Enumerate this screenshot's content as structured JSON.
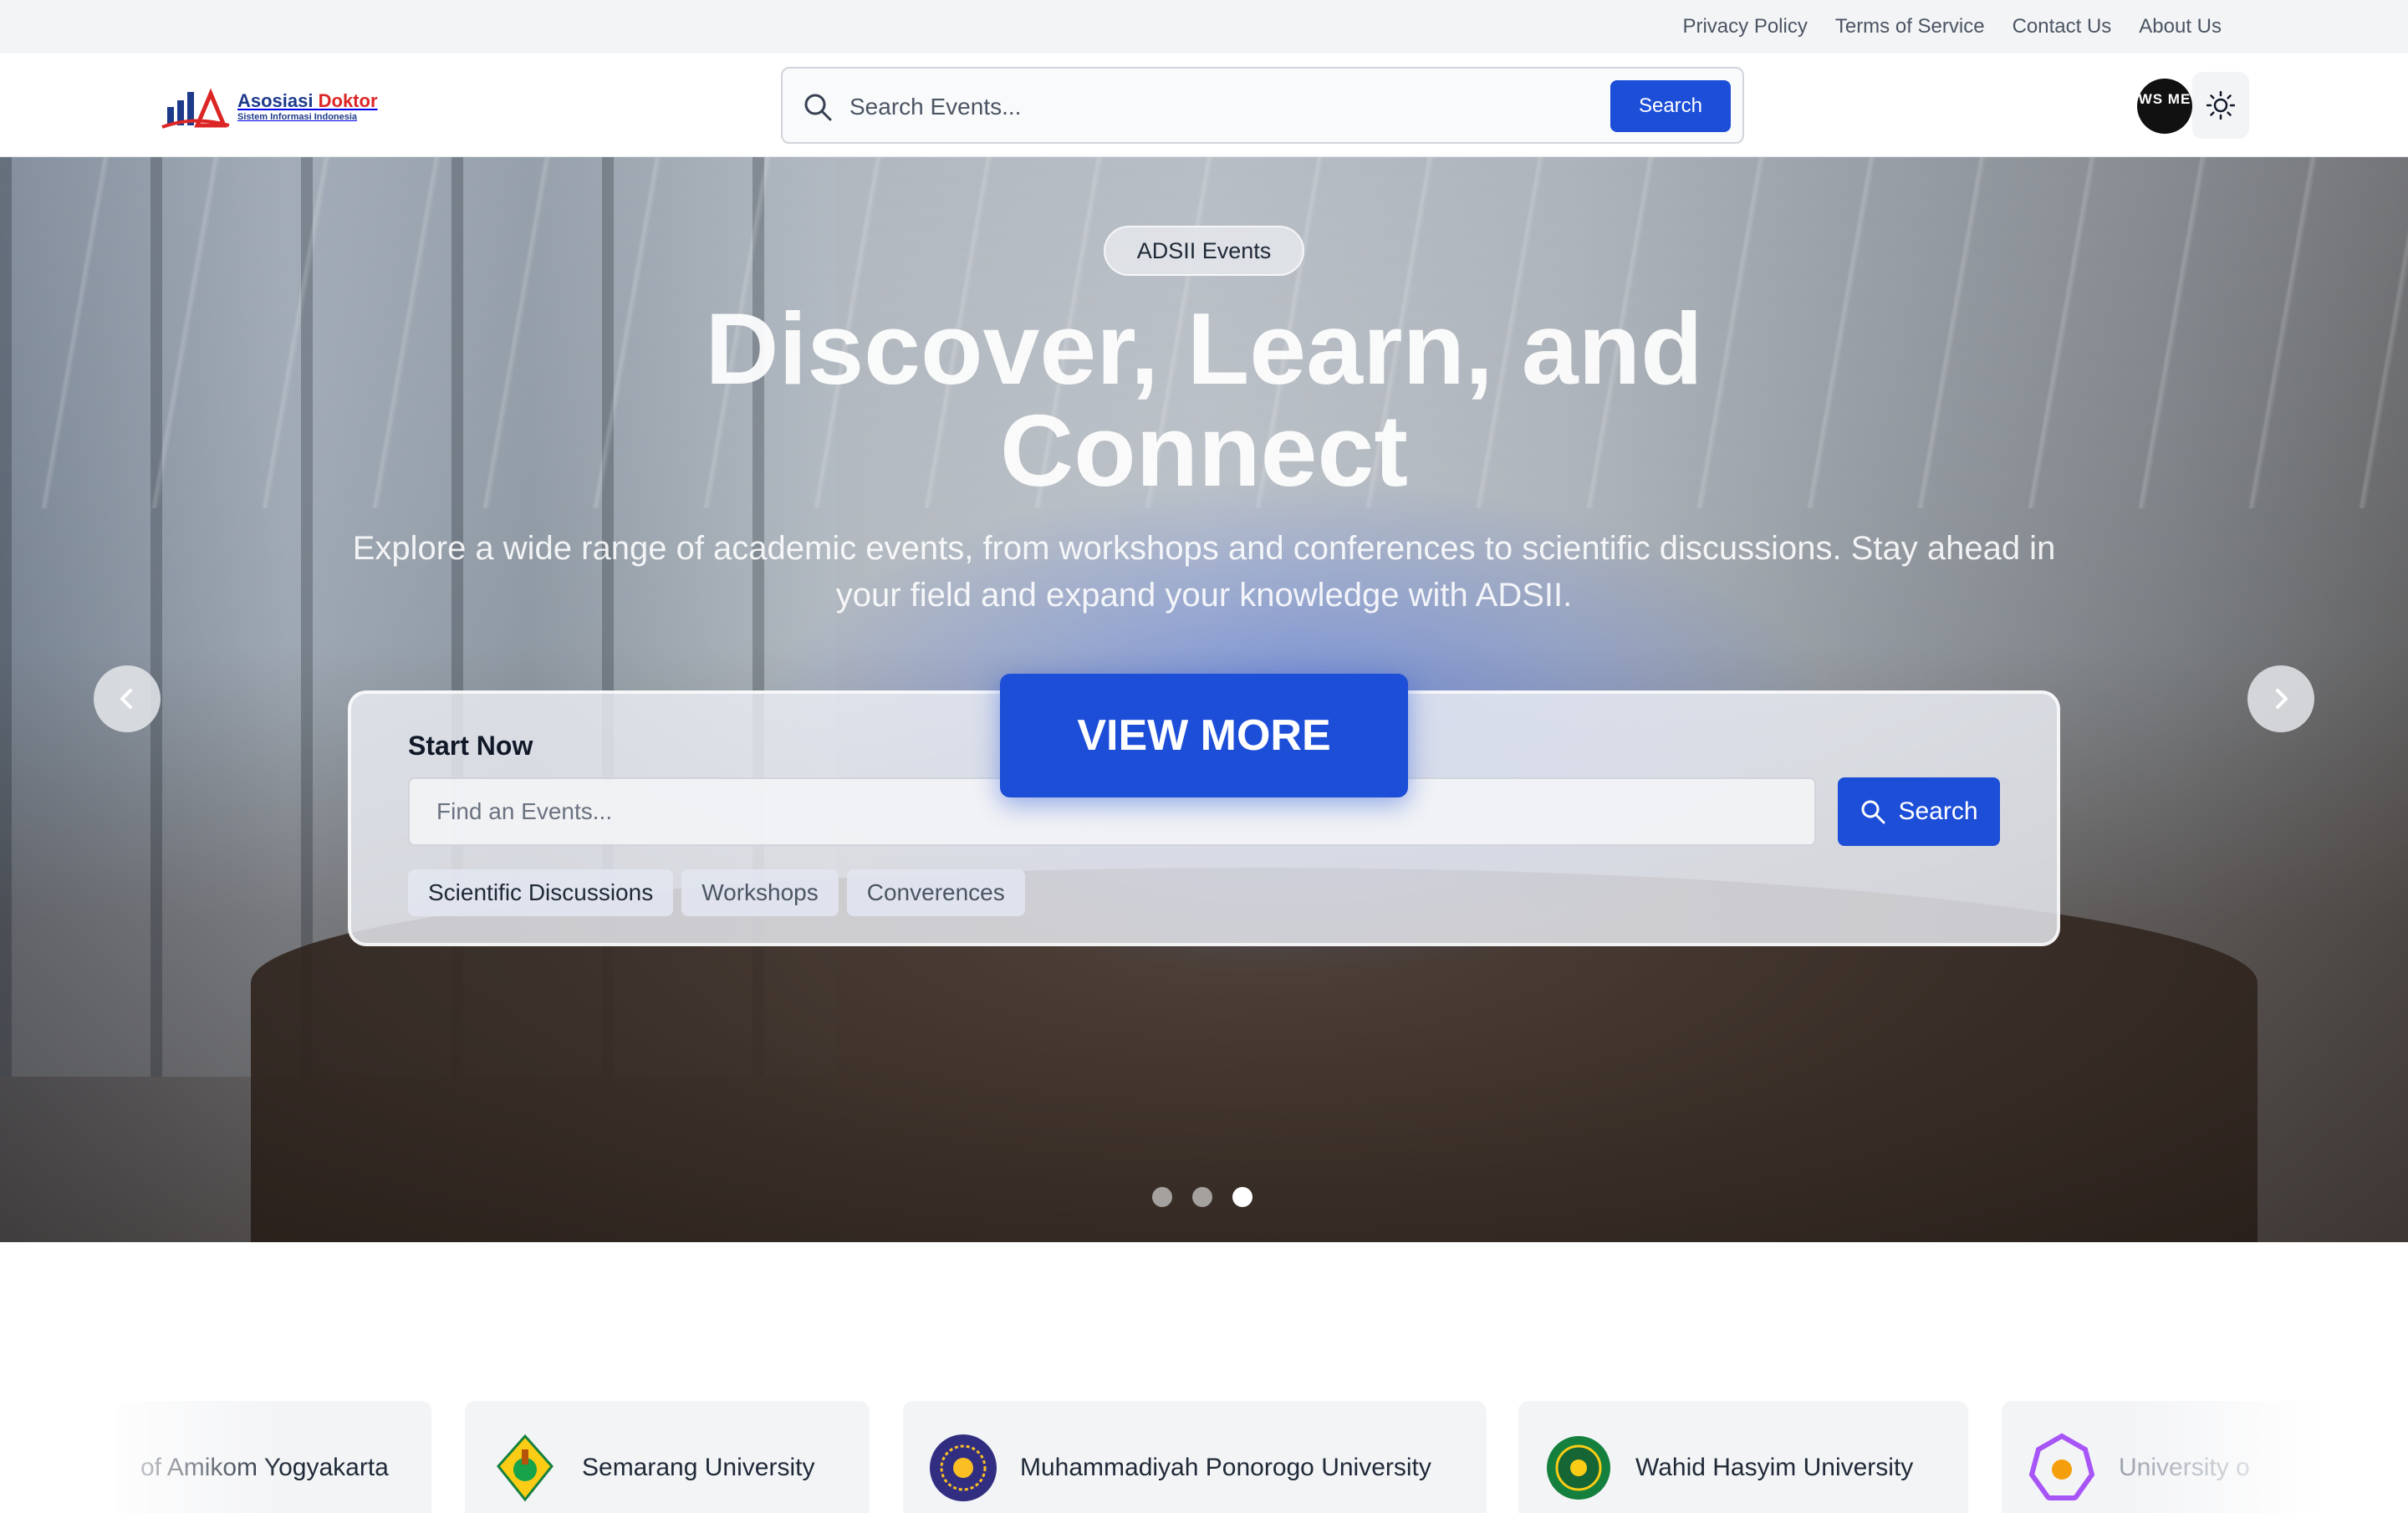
{
  "topbar": {
    "links": [
      "Privacy Policy",
      "Terms of Service",
      "Contact Us",
      "About Us"
    ]
  },
  "header": {
    "logo": {
      "line1a": "Asosiasi",
      "line1b": "Doktor",
      "line2": "Sistem Informasi Indonesia"
    },
    "search": {
      "placeholder": "Search Events...",
      "button": "Search"
    },
    "avatar_initials": "WS ME",
    "theme_icon": "sun-icon"
  },
  "hero": {
    "badge": "ADSII Events",
    "title": "Discover, Learn, and Connect",
    "subtitle": "Explore a wide range of academic events, from workshops and conferences to scientific discussions. Stay ahead in your field and expand your knowledge with ADSII.",
    "cta": "VIEW MORE",
    "search_card": {
      "title": "Start Now",
      "placeholder": "Find an Events...",
      "button": "Search",
      "chips": [
        "Scientific Discussions",
        "Workshops",
        "Converences"
      ]
    },
    "carousel": {
      "slides": 3,
      "active": 3
    }
  },
  "partners": [
    "of Amikom Yogyakarta",
    "Semarang University",
    "Muhammadiyah Ponorogo University",
    "Wahid Hasyim University",
    "University o"
  ],
  "colors": {
    "primary": "#1d4ed8",
    "topbar": "#f3f4f6"
  }
}
